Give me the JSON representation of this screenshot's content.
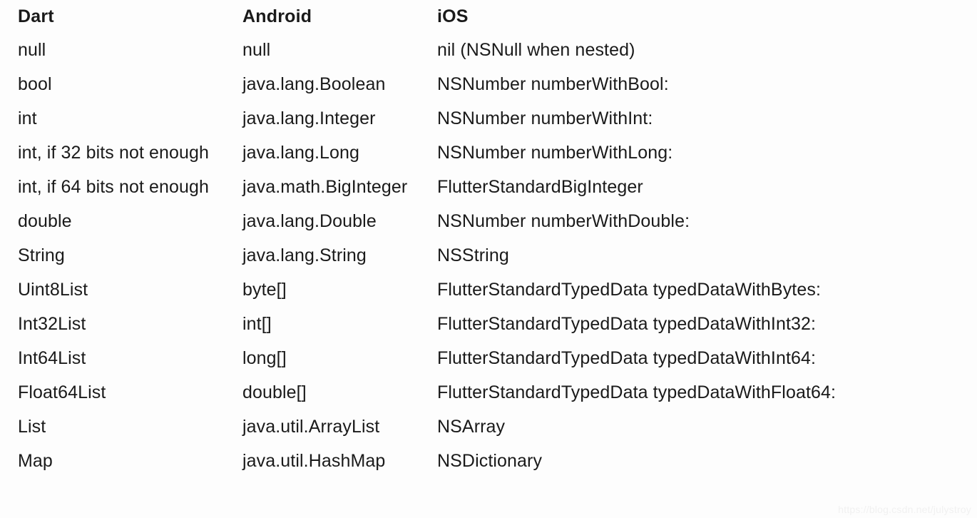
{
  "table": {
    "columns": [
      {
        "key": "dart",
        "label": "Dart"
      },
      {
        "key": "android",
        "label": "Android"
      },
      {
        "key": "ios",
        "label": "iOS"
      }
    ],
    "rows": [
      {
        "dart": "null",
        "android": "null",
        "ios": "nil (NSNull when nested)"
      },
      {
        "dart": "bool",
        "android": "java.lang.Boolean",
        "ios": "NSNumber numberWithBool:"
      },
      {
        "dart": "int",
        "android": "java.lang.Integer",
        "ios": "NSNumber numberWithInt:"
      },
      {
        "dart": "int, if 32 bits not enough",
        "android": "java.lang.Long",
        "ios": "NSNumber numberWithLong:"
      },
      {
        "dart": "int, if 64 bits not enough",
        "android": "java.math.BigInteger",
        "ios": "FlutterStandardBigInteger"
      },
      {
        "dart": "double",
        "android": "java.lang.Double",
        "ios": "NSNumber numberWithDouble:"
      },
      {
        "dart": "String",
        "android": "java.lang.String",
        "ios": "NSString"
      },
      {
        "dart": "Uint8List",
        "android": "byte[]",
        "ios": "FlutterStandardTypedData typedDataWithBytes:"
      },
      {
        "dart": "Int32List",
        "android": "int[]",
        "ios": "FlutterStandardTypedData typedDataWithInt32:"
      },
      {
        "dart": "Int64List",
        "android": "long[]",
        "ios": "FlutterStandardTypedData typedDataWithInt64:"
      },
      {
        "dart": "Float64List",
        "android": "double[]",
        "ios": "FlutterStandardTypedData typedDataWithFloat64:"
      },
      {
        "dart": "List",
        "android": "java.util.ArrayList",
        "ios": "NSArray"
      },
      {
        "dart": "Map",
        "android": "java.util.HashMap",
        "ios": "NSDictionary"
      }
    ]
  },
  "watermark": {
    "text": "https://blog.csdn.net/julystroy"
  },
  "colors": {
    "background": "#fdfdfd",
    "text": "#1a1a1a",
    "watermark": "#f1f1f1"
  }
}
